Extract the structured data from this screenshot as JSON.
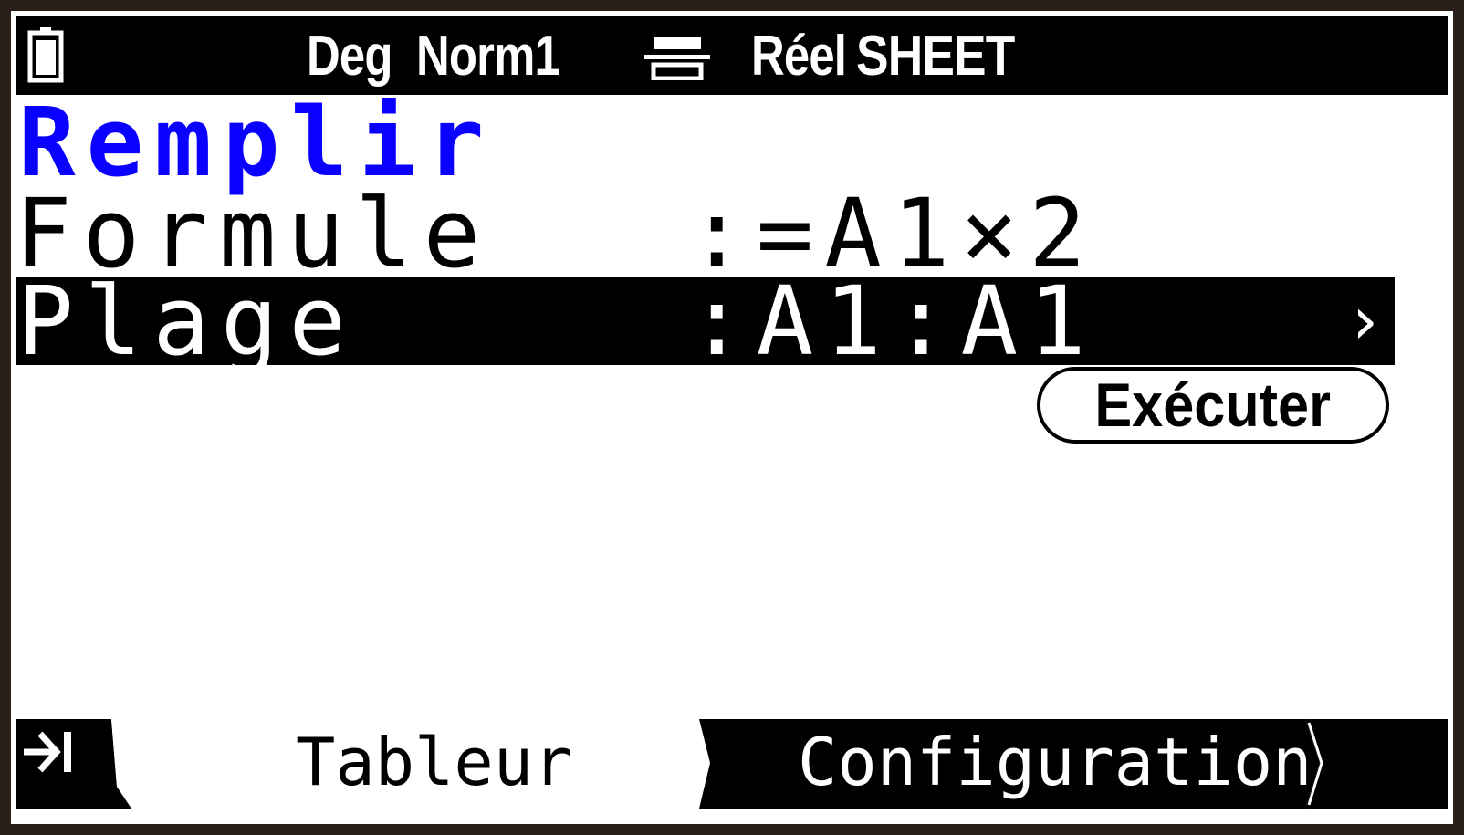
{
  "statusbar": {
    "angle": "Deg",
    "display": "Norm1",
    "complex": "Réel",
    "app": "SHEET",
    "icons": [
      "battery-icon",
      "input-mode-icon"
    ]
  },
  "screen": {
    "title": "Remplir",
    "rows": [
      {
        "label": "Formule",
        "value": ":=A1×2"
      },
      {
        "label": "Plage",
        "value": ":A1:A1",
        "selected": true,
        "arrow": "›"
      }
    ],
    "execute_label": "Exécuter",
    "title_color": "#0a00ff"
  },
  "tabs": {
    "tableur": "Tableur",
    "configuration": "Configuration",
    "end_icon": "skip-to-end-icon"
  }
}
